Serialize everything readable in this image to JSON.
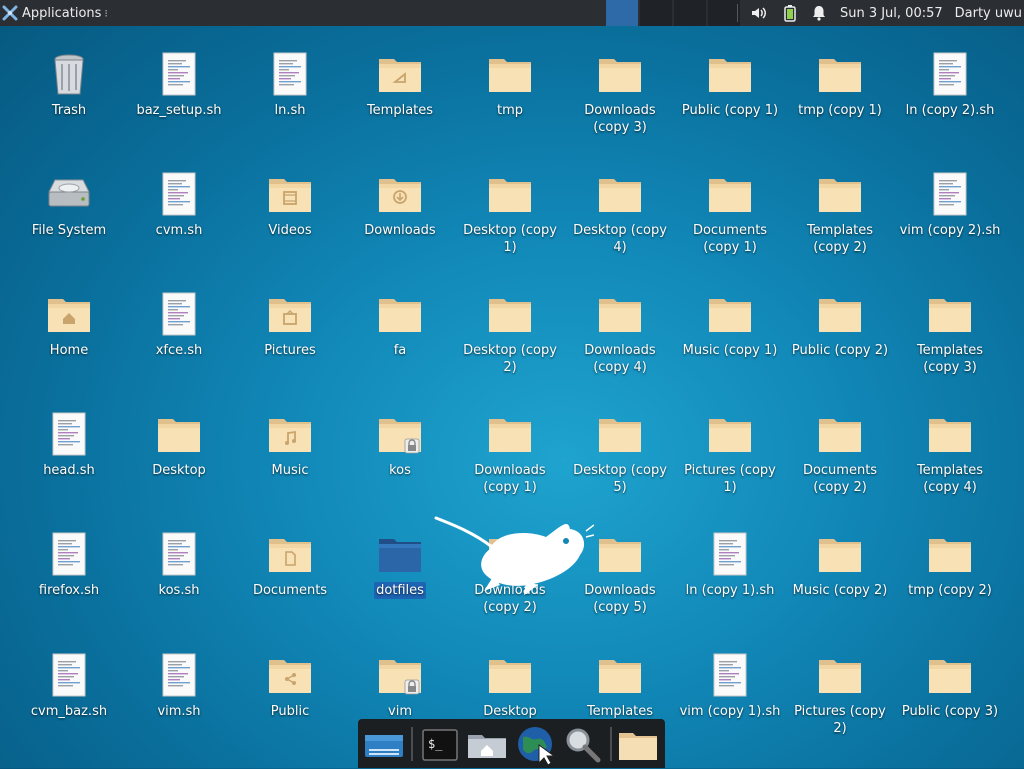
{
  "panel": {
    "applications_label": "Applications",
    "menu_marker": "⁝",
    "clock": "Sun  3 Jul, 00:57",
    "user": "Darty uwu"
  },
  "desktop": {
    "icons": [
      {
        "label": "Trash",
        "type": "trash"
      },
      {
        "label": "baz_setup.sh",
        "type": "script"
      },
      {
        "label": "ln.sh",
        "type": "script"
      },
      {
        "label": "Templates",
        "type": "folder-templates"
      },
      {
        "label": "tmp",
        "type": "folder"
      },
      {
        "label": "Downloads (copy 3)",
        "type": "folder"
      },
      {
        "label": "Public (copy 1)",
        "type": "folder"
      },
      {
        "label": "tmp (copy 1)",
        "type": "folder"
      },
      {
        "label": "ln (copy 2).sh",
        "type": "script"
      },
      {
        "label": "File System",
        "type": "drive"
      },
      {
        "label": "cvm.sh",
        "type": "script"
      },
      {
        "label": "Videos",
        "type": "folder-videos"
      },
      {
        "label": "Downloads",
        "type": "folder-downloads"
      },
      {
        "label": "Desktop (copy 1)",
        "type": "folder"
      },
      {
        "label": "Desktop (copy 4)",
        "type": "folder"
      },
      {
        "label": "Documents (copy 1)",
        "type": "folder"
      },
      {
        "label": "Templates (copy 2)",
        "type": "folder"
      },
      {
        "label": "vim (copy 2).sh",
        "type": "script"
      },
      {
        "label": "Home",
        "type": "folder-home"
      },
      {
        "label": "xfce.sh",
        "type": "script"
      },
      {
        "label": "Pictures",
        "type": "folder-pictures"
      },
      {
        "label": "fa",
        "type": "folder"
      },
      {
        "label": "Desktop (copy 2)",
        "type": "folder"
      },
      {
        "label": "Downloads (copy 4)",
        "type": "folder"
      },
      {
        "label": "Music (copy 1)",
        "type": "folder"
      },
      {
        "label": "Public (copy 2)",
        "type": "folder"
      },
      {
        "label": "Templates (copy 3)",
        "type": "folder"
      },
      {
        "label": "head.sh",
        "type": "script"
      },
      {
        "label": "Desktop",
        "type": "folder"
      },
      {
        "label": "Music",
        "type": "folder-music"
      },
      {
        "label": "kos",
        "type": "folder-locked"
      },
      {
        "label": "Downloads (copy 1)",
        "type": "folder"
      },
      {
        "label": "Desktop (copy 5)",
        "type": "folder"
      },
      {
        "label": "Pictures (copy 1)",
        "type": "folder"
      },
      {
        "label": "Documents (copy 2)",
        "type": "folder"
      },
      {
        "label": "Templates (copy 4)",
        "type": "folder"
      },
      {
        "label": "firefox.sh",
        "type": "script"
      },
      {
        "label": "kos.sh",
        "type": "script"
      },
      {
        "label": "Documents",
        "type": "folder-documents"
      },
      {
        "label": "dotfiles",
        "type": "folder-selected",
        "selected": true
      },
      {
        "label": "Downloads (copy 2)",
        "type": "folder"
      },
      {
        "label": "Downloads (copy 5)",
        "type": "folder"
      },
      {
        "label": "ln (copy 1).sh",
        "type": "script"
      },
      {
        "label": "Music (copy 2)",
        "type": "folder"
      },
      {
        "label": "tmp (copy 2)",
        "type": "folder"
      },
      {
        "label": "cvm_baz.sh",
        "type": "script"
      },
      {
        "label": "vim.sh",
        "type": "script"
      },
      {
        "label": "Public",
        "type": "folder-public"
      },
      {
        "label": "vim",
        "type": "folder-locked"
      },
      {
        "label": "Desktop",
        "type": "folder"
      },
      {
        "label": "Templates",
        "type": "folder"
      },
      {
        "label": "vim (copy 1).sh",
        "type": "script"
      },
      {
        "label": "Pictures (copy 2)",
        "type": "folder"
      },
      {
        "label": "Public (copy 3)",
        "type": "folder"
      }
    ]
  },
  "dock": {
    "items": [
      {
        "name": "show-desktop-icon"
      },
      {
        "name": "terminal-icon"
      },
      {
        "name": "home-folder-icon"
      },
      {
        "name": "web-browser-icon"
      },
      {
        "name": "app-finder-icon"
      },
      {
        "name": "folder-icon"
      }
    ]
  }
}
